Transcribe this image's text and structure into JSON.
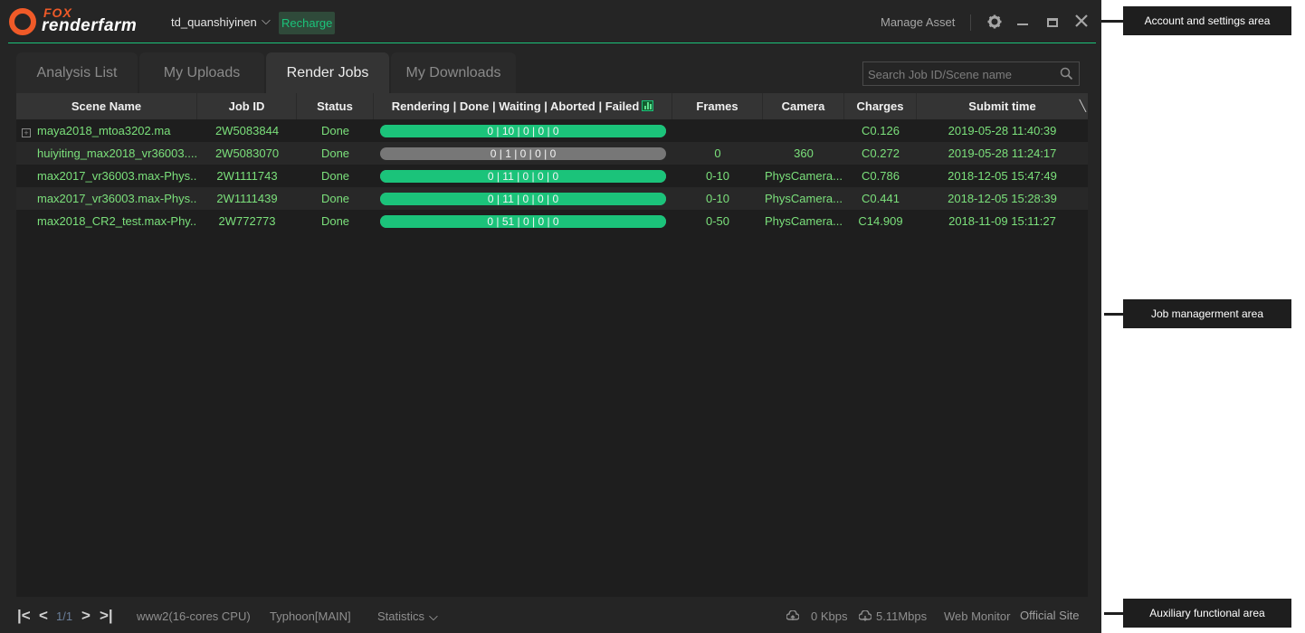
{
  "app": {
    "logo_top": "FOX",
    "logo_bottom": "renderfarm",
    "username": "td_quanshiyinen",
    "recharge_label": "Recharge",
    "manage_asset_label": "Manage Asset",
    "icons": [
      "settings-gear-icon",
      "minimize-icon",
      "maximize-icon",
      "close-icon"
    ]
  },
  "tabs": [
    {
      "label": "Analysis List",
      "active": false
    },
    {
      "label": "My Uploads",
      "active": false
    },
    {
      "label": "Render Jobs",
      "active": true
    },
    {
      "label": "My Downloads",
      "active": false
    }
  ],
  "search": {
    "placeholder": "Search Job ID/Scene name",
    "value": ""
  },
  "table": {
    "columns": [
      "Scene Name",
      "Job ID",
      "Status",
      "Rendering | Done | Waiting | Aborted | Failed",
      "Frames",
      "Camera",
      "Charges",
      "Submit time"
    ],
    "rows": [
      {
        "scene": "maya2018_mtoa3202.ma",
        "job_id": "2W5083844",
        "status": "Done",
        "progress": "0 | 10 | 0 | 0 | 0",
        "progress_fraction": 1.0,
        "progress_color": "#1bc37a",
        "frames": "",
        "camera": "",
        "charges": "C0.126",
        "submit_time": "2019-05-28 11:40:39",
        "expandable": true
      },
      {
        "scene": "huiyiting_max2018_vr36003....",
        "job_id": "2W5083070",
        "status": "Done",
        "progress": "0 | 1 | 0 | 0 | 0",
        "progress_fraction": 0.0,
        "progress_color": "#777777",
        "frames": "0",
        "camera": "360",
        "charges": "C0.272",
        "submit_time": "2019-05-28 11:24:17",
        "expandable": false
      },
      {
        "scene": "max2017_vr36003.max-Phys...",
        "job_id": "2W1111743",
        "status": "Done",
        "progress": "0 | 11 | 0 | 0 | 0",
        "progress_fraction": 1.0,
        "progress_color": "#1bc37a",
        "frames": "0-10",
        "camera": "PhysCamera...",
        "charges": "C0.786",
        "submit_time": "2018-12-05 15:47:49",
        "expandable": false
      },
      {
        "scene": "max2017_vr36003.max-Phys...",
        "job_id": "2W1111439",
        "status": "Done",
        "progress": "0 | 11 | 0 | 0 | 0",
        "progress_fraction": 1.0,
        "progress_color": "#1bc37a",
        "frames": "0-10",
        "camera": "PhysCamera...",
        "charges": "C0.441",
        "submit_time": "2018-12-05 15:28:39",
        "expandable": false
      },
      {
        "scene": "max2018_CR2_test.max-Phy...",
        "job_id": "2W772773",
        "status": "Done",
        "progress": "0 | 51 | 0 | 0 | 0",
        "progress_fraction": 1.0,
        "progress_color": "#1bc37a",
        "frames": "0-50",
        "camera": "PhysCamera...",
        "charges": "C14.909",
        "submit_time": "2018-11-09 15:11:27",
        "expandable": false
      }
    ]
  },
  "footer": {
    "page": "1/1",
    "platform": "www2(16-cores CPU)",
    "transfer_line": "Typhoon[MAIN]",
    "statistics_label": "Statistics",
    "upload_speed": "0 Kbps",
    "download_speed": "5.11Mbps",
    "web_monitor_label": "Web Monitor",
    "official_site_label": "Official Site"
  },
  "annotations": {
    "account": "Account and settings area",
    "job": "Job managerment area",
    "aux": "Auxiliary functional area"
  }
}
